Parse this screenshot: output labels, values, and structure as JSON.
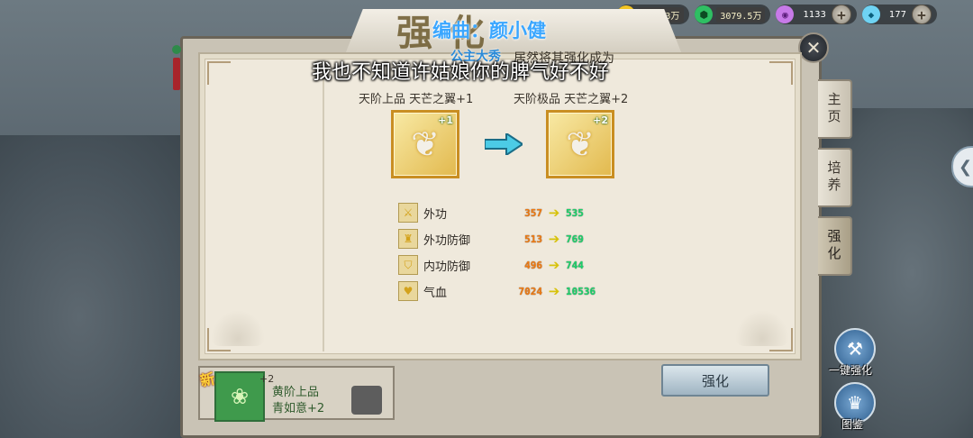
{
  "currency": {
    "gold": "783.3万",
    "jade": "3079.5万",
    "pearl": "1133",
    "diamond": "177",
    "plus": "+"
  },
  "window": {
    "title_calligraphy": "强化",
    "close_icon": "✕"
  },
  "subtitles": {
    "line1": "编曲：颜小健",
    "line1_small": "公主大秀",
    "line2": "我也不知道许姑娘你的脾气好不好"
  },
  "result": {
    "success_text": "居然将其强化成为"
  },
  "items": {
    "before": {
      "label": "天阶上品 天芒之翼+1",
      "plus": "+1"
    },
    "after": {
      "label": "天阶极品 天芒之翼+2",
      "plus": "+2"
    }
  },
  "stats": [
    {
      "name": "外功",
      "old": "357",
      "new": "535"
    },
    {
      "name": "外功防御",
      "old": "513",
      "new": "769"
    },
    {
      "name": "内功防御",
      "old": "496",
      "new": "744"
    },
    {
      "name": "气血",
      "old": "7024",
      "new": "10536"
    }
  ],
  "side_tabs": {
    "home": "主页",
    "train": "培养",
    "strengthen": "强化"
  },
  "list": {
    "new_tag": "新",
    "plus": "+2",
    "name_line1": "黄阶上品",
    "name_line2": "青如意+2"
  },
  "buttons": {
    "strengthen": "强化",
    "one_click": "一键强化",
    "atlas": "图鉴"
  }
}
